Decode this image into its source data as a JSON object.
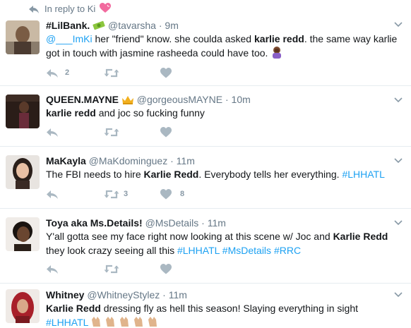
{
  "reply_header": {
    "text": "In reply to Ki"
  },
  "tweets": [
    {
      "name": "#LilBank.",
      "handle": "@tavarsha",
      "time": "9m",
      "mention": "@___ImKi",
      "text_parts": [
        " her \"friend\" know. she coulda asked ",
        "karlie redd",
        ". the same way karlie got in touch with jasmine rasheeda could have too. "
      ],
      "reply_count": "2",
      "retweet_count": "",
      "like_count": ""
    },
    {
      "name": "QUEEN.MAYNE",
      "handle": "@gorgeousMAYNE",
      "time": "10m",
      "text_parts": [
        "karlie redd",
        " and joc so fucking funny"
      ],
      "reply_count": "",
      "retweet_count": "",
      "like_count": ""
    },
    {
      "name": "MaKayla",
      "handle": "@MaKdominguez",
      "time": "11m",
      "text_parts": [
        "The FBI needs to hire ",
        "Karlie Redd",
        ". Everybody tells her everything. ",
        "#LHHATL"
      ],
      "reply_count": "",
      "retweet_count": "3",
      "like_count": "8"
    },
    {
      "name": "Toya aka Ms.Details!",
      "handle": "@MsDetails",
      "time": "11m",
      "text_parts": [
        "Y'all gotta see my face right now looking at this scene w/ Joc and ",
        "Karlie Redd",
        " they look crazy seeing all this ",
        "#LHHATL",
        " ",
        "#MsDetails",
        " ",
        "#RRC"
      ],
      "reply_count": "",
      "retweet_count": "",
      "like_count": ""
    },
    {
      "name": "Whitney",
      "handle": "@WhitneyStylez",
      "time": "11m",
      "text_parts": [
        "Karlie Redd",
        " dressing fly as hell this season! Slaying everything in sight",
        "#LHHATL"
      ]
    }
  ],
  "separator": "·",
  "icons": {
    "reply_arrow": "reply-arrow-icon",
    "heart_emoji": "pink-heart-emoji",
    "money_emoji": "money-bag-emoji",
    "crown_emoji": "crown-emoji",
    "facepalm_emoji": "facepalm-emoji",
    "clap_emoji": "clapping-hands-emoji",
    "reply": "reply-icon",
    "retweet": "retweet-icon",
    "like": "heart-icon",
    "more": "chevron-down-icon"
  },
  "colors": {
    "link": "#1da1f2",
    "muted": "#657786",
    "action_icon": "#aab8c2",
    "divider": "#e6ecf0",
    "heart_emoji": "#f26a9e"
  }
}
